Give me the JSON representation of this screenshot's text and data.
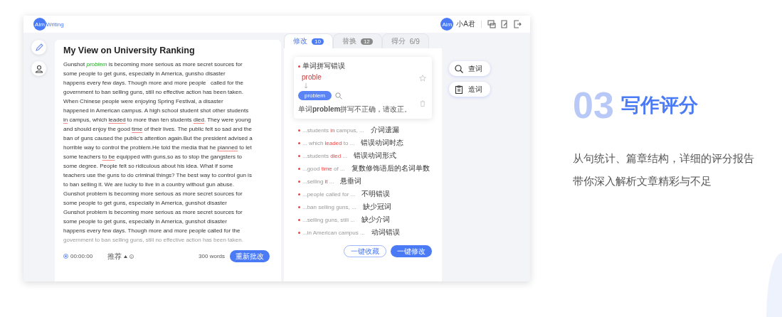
{
  "header": {
    "logo_badge": "Aim",
    "logo_text": "Writing",
    "avatar": "Aim",
    "user": "小A君"
  },
  "essay": {
    "title": "My View on University Ranking",
    "lines": [
      [
        {
          "text": "Gunshot ",
          "kind": "plain"
        },
        {
          "text": "problem",
          "kind": "fixed"
        },
        {
          "text": " is becoming more serious as more secret sources for",
          "kind": "plain"
        }
      ],
      [
        {
          "text": "some people to get guns, especially in America, gunsho disaster",
          "kind": "plain"
        }
      ],
      [
        {
          "text": "happens every few days. Though more and more people   called for the",
          "kind": "plain"
        }
      ],
      [
        {
          "text": "government to ban selling guns, still no effective action has been taken.",
          "kind": "plain"
        }
      ],
      [
        {
          "text": "When Chinese people were enjoying Spring Festival, a disaster",
          "kind": "plain"
        }
      ],
      [
        {
          "text": "happened in American campus. A high school student shot other students",
          "kind": "plain"
        }
      ],
      [
        {
          "text": "in",
          "kind": "error"
        },
        {
          "text": " campus, which ",
          "kind": "plain"
        },
        {
          "text": "leaded",
          "kind": "error"
        },
        {
          "text": " to more than ten students ",
          "kind": "plain"
        },
        {
          "text": "died",
          "kind": "error"
        },
        {
          "text": ". They were young",
          "kind": "plain"
        }
      ],
      [
        {
          "text": "and should enjoy the good ",
          "kind": "plain"
        },
        {
          "text": "time",
          "kind": "error"
        },
        {
          "text": " of their lives. The public felt so sad and the",
          "kind": "plain"
        }
      ],
      [
        {
          "text": "ban of guns caused the public's attention again.But the president advised a",
          "kind": "plain"
        }
      ],
      [
        {
          "text": "horrible way to control the problem.He told the media that he ",
          "kind": "plain"
        },
        {
          "text": "planned",
          "kind": "error"
        },
        {
          "text": " to let",
          "kind": "plain"
        }
      ],
      [
        {
          "text": "some teachers ",
          "kind": "plain"
        },
        {
          "text": "to be",
          "kind": "error"
        },
        {
          "text": " equipped with guns,so as to stop the gangsters to",
          "kind": "plain"
        }
      ],
      [
        {
          "text": "some degree. People felt so ridiculous about his idea. What if some",
          "kind": "plain"
        }
      ],
      [
        {
          "text": "teachers use the guns to do criminal things? The best way to control gun is",
          "kind": "plain"
        }
      ],
      [
        {
          "text": "to ban selling it. We are lucky to live in a country without gun abuse.",
          "kind": "plain"
        }
      ],
      [
        {
          "text": "Gunshot problem is becoming more serious as more secret sources for",
          "kind": "plain"
        }
      ],
      [
        {
          "text": "some people to get guns, especially in America, gunshot disaster",
          "kind": "plain"
        }
      ],
      [
        {
          "text": "Gunshot problem is becoming more serious as more secret sources for",
          "kind": "plain"
        }
      ],
      [
        {
          "text": "some people to get guns, especially in America, gunshot disaster",
          "kind": "plain"
        }
      ],
      [
        {
          "text": "happens every few days. Though more and more people called for the",
          "kind": "plain"
        }
      ],
      [
        {
          "text": "government to ban selling guns, still no effective action has been taken.",
          "kind": "faded"
        }
      ]
    ],
    "time": "00:00:00",
    "level": "推荐",
    "words": "300  words",
    "resubmit": "重新批改"
  },
  "tabs": [
    {
      "label": "修改",
      "badge": "10",
      "selected": true
    },
    {
      "label": "替换",
      "badge": "12",
      "selected": false
    },
    {
      "label": "得分",
      "badge": "6/9",
      "selected": false
    }
  ],
  "card": {
    "title": "单词拼写错误",
    "wrong": "proble",
    "suggestion": "problem",
    "note": "单词**problem**拼写不正确，请改正。"
  },
  "issues": [
    {
      "snippet": [
        {
          "text": "...students ",
          "kind": "plain"
        },
        {
          "text": "in",
          "kind": "error"
        },
        {
          "text": " campus, ...",
          "kind": "plain"
        }
      ],
      "label": "介词遗漏"
    },
    {
      "snippet": [
        {
          "text": "... which ",
          "kind": "plain"
        },
        {
          "text": "leaded",
          "kind": "error"
        },
        {
          "text": " to ...",
          "kind": "plain"
        }
      ],
      "label": "错误动词时态"
    },
    {
      "snippet": [
        {
          "text": "...students ",
          "kind": "plain"
        },
        {
          "text": "died",
          "kind": "error"
        },
        {
          "text": " ...",
          "kind": "plain"
        }
      ],
      "label": "错误动词形式"
    },
    {
      "snippet": [
        {
          "text": "...good ",
          "kind": "plain"
        },
        {
          "text": "time",
          "kind": "error"
        },
        {
          "text": " of ...",
          "kind": "plain"
        }
      ],
      "label": "复数修饰语后的名词单数"
    },
    {
      "snippet": [
        {
          "text": "...selling ",
          "kind": "plain"
        },
        {
          "text": "it",
          "kind": "error"
        },
        {
          "text": " ...",
          "kind": "plain"
        }
      ],
      "label": "悬垂词"
    },
    {
      "snippet": [
        {
          "text": "...people called for ...",
          "kind": "plain"
        }
      ],
      "label": "不明错误"
    },
    {
      "snippet": [
        {
          "text": "...ban selling guns, ...",
          "kind": "plain"
        }
      ],
      "label": "缺少冠词"
    },
    {
      "snippet": [
        {
          "text": "...selling guns, still ...",
          "kind": "plain"
        }
      ],
      "label": "缺少介词"
    },
    {
      "snippet": [
        {
          "text": "...in American campus ...",
          "kind": "plain"
        }
      ],
      "label": "动词错误"
    }
  ],
  "panel_buttons": [
    "一键收藏",
    "一键修改"
  ],
  "tools": [
    {
      "label": "查词",
      "kind": "search"
    },
    {
      "label": "造词",
      "kind": "clipboard"
    }
  ],
  "feature": {
    "number": "03",
    "title": "写作评分",
    "lines": [
      "从句统计、篇章结构，详细的评分报告",
      "带你深入解析文章精彩与不足"
    ]
  }
}
